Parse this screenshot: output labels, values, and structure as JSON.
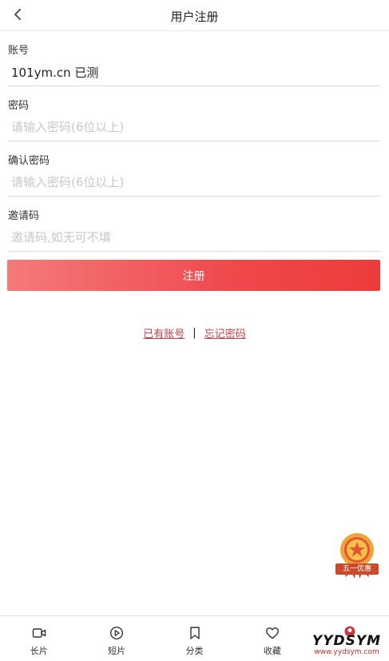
{
  "header": {
    "title": "用户注册"
  },
  "form": {
    "account": {
      "label": "账号",
      "value": "101ym.cn 已测",
      "placeholder": ""
    },
    "password": {
      "label": "密码",
      "value": "",
      "placeholder": "请输入密码(6位以上)"
    },
    "confirm": {
      "label": "确认密码",
      "value": "",
      "placeholder": "请输入密码(6位以上)"
    },
    "invite": {
      "label": "邀请码",
      "value": "",
      "placeholder": "邀请码,如无可不填"
    },
    "submit_label": "注册"
  },
  "links": {
    "has_account": "已有账号",
    "separator": "|",
    "forgot": "忘记密码"
  },
  "badge": {
    "text": "五一优惠"
  },
  "tabbar": {
    "items": [
      {
        "label": "长片",
        "icon": "video-camera-icon"
      },
      {
        "label": "短片",
        "icon": "play-circle-icon"
      },
      {
        "label": "分类",
        "icon": "bookmark-icon"
      },
      {
        "label": "收藏",
        "icon": "heart-icon"
      },
      {
        "label": "",
        "icon": "user-icon"
      }
    ]
  },
  "watermark": {
    "brand": "YYDSYM",
    "site": "www.yydsym.com"
  },
  "colors": {
    "accent": "#f0494c",
    "link": "#c0424b"
  }
}
